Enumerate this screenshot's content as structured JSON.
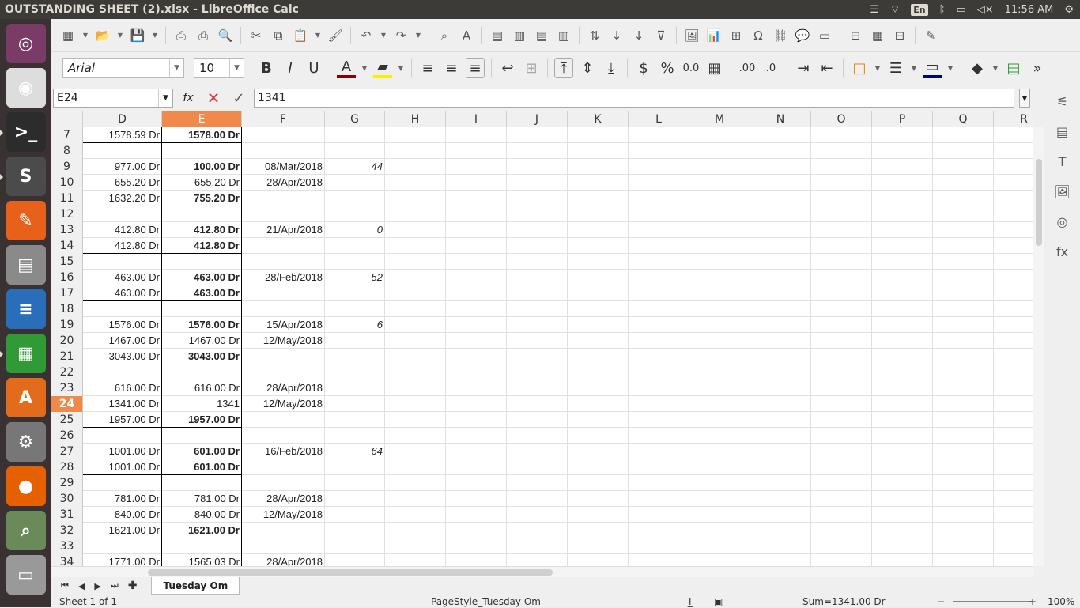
{
  "window": {
    "title": "OUTSTANDING  SHEET (2).xlsx - LibreOffice Calc"
  },
  "tray": {
    "lang": "En",
    "clock": "11:56 AM"
  },
  "launcher": [
    {
      "name": "ubuntu-dash-icon",
      "glyph": "◎",
      "color": "#7a3b67"
    },
    {
      "name": "chrome-icon",
      "glyph": "◉",
      "color": "#dddddd"
    },
    {
      "name": "terminal-icon",
      "glyph": ">_",
      "color": "#2c2c2c"
    },
    {
      "name": "sublime-text-icon",
      "glyph": "S",
      "color": "#4b4b4b"
    },
    {
      "name": "gpick-icon",
      "glyph": "✎",
      "color": "#e8611a"
    },
    {
      "name": "files-icon",
      "glyph": "▤",
      "color": "#8a8a8a"
    },
    {
      "name": "writer-icon",
      "glyph": "≡",
      "color": "#2a6db8"
    },
    {
      "name": "calc-icon",
      "glyph": "▦",
      "color": "#2f9a36"
    },
    {
      "name": "software-center-icon",
      "glyph": "A",
      "color": "#e36b1c"
    },
    {
      "name": "settings-icon",
      "glyph": "⚙",
      "color": "#777777"
    },
    {
      "name": "firefox-icon",
      "glyph": "●",
      "color": "#e66000"
    },
    {
      "name": "image-viewer-icon",
      "glyph": "⌕",
      "color": "#6a8a5a"
    },
    {
      "name": "trash-icon",
      "glyph": "▭",
      "color": "#999999"
    }
  ],
  "toolbar": {
    "font_name": "Arial",
    "font_size": "10"
  },
  "formula_bar": {
    "name_box": "E24",
    "fx": "fx",
    "value": "1341"
  },
  "columns": [
    "D",
    "E",
    "F",
    "G",
    "H",
    "I",
    "J",
    "K",
    "L",
    "M",
    "N",
    "O",
    "P",
    "Q",
    "R"
  ],
  "selected_column": "E",
  "rows": [
    {
      "n": "7",
      "d": "1578.59 Dr",
      "e": "1578.00 Dr",
      "eb": true,
      "f": "",
      "g": "",
      "bb": true
    },
    {
      "n": "8",
      "d": "",
      "e": "",
      "f": "",
      "g": ""
    },
    {
      "n": "9",
      "d": "977.00 Dr",
      "e": "100.00 Dr",
      "eb": true,
      "f": "08/Mar/2018",
      "g": "44"
    },
    {
      "n": "10",
      "d": "655.20 Dr",
      "e": "655.20 Dr",
      "f": "28/Apr/2018",
      "g": ""
    },
    {
      "n": "11",
      "d": "1632.20 Dr",
      "e": "755.20 Dr",
      "eb": true,
      "f": "",
      "g": "",
      "bb": true
    },
    {
      "n": "12",
      "d": "",
      "e": "",
      "f": "",
      "g": ""
    },
    {
      "n": "13",
      "d": "412.80 Dr",
      "e": "412.80 Dr",
      "eb": true,
      "f": "21/Apr/2018",
      "g": "0"
    },
    {
      "n": "14",
      "d": "412.80 Dr",
      "e": "412.80 Dr",
      "eb": true,
      "f": "",
      "g": "",
      "bb": true
    },
    {
      "n": "15",
      "d": "",
      "e": "",
      "f": "",
      "g": ""
    },
    {
      "n": "16",
      "d": "463.00 Dr",
      "e": "463.00 Dr",
      "eb": true,
      "f": "28/Feb/2018",
      "g": "52"
    },
    {
      "n": "17",
      "d": "463.00 Dr",
      "e": "463.00 Dr",
      "eb": true,
      "f": "",
      "g": "",
      "bb": true
    },
    {
      "n": "18",
      "d": "",
      "e": "",
      "f": "",
      "g": ""
    },
    {
      "n": "19",
      "d": "1576.00 Dr",
      "e": "1576.00 Dr",
      "eb": true,
      "f": "15/Apr/2018",
      "g": "6"
    },
    {
      "n": "20",
      "d": "1467.00 Dr",
      "e": "1467.00 Dr",
      "f": "12/May/2018",
      "g": ""
    },
    {
      "n": "21",
      "d": "3043.00 Dr",
      "e": "3043.00 Dr",
      "eb": true,
      "f": "",
      "g": "",
      "bb": true
    },
    {
      "n": "22",
      "d": "",
      "e": "",
      "f": "",
      "g": ""
    },
    {
      "n": "23",
      "d": "616.00 Dr",
      "e": "616.00 Dr",
      "f": "28/Apr/2018",
      "g": ""
    },
    {
      "n": "24",
      "d": "1341.00 Dr",
      "e": "1341",
      "f": "12/May/2018",
      "g": "",
      "sel": true
    },
    {
      "n": "25",
      "d": "1957.00 Dr",
      "e": "1957.00 Dr",
      "eb": true,
      "f": "",
      "g": "",
      "bb": true
    },
    {
      "n": "26",
      "d": "",
      "e": "",
      "f": "",
      "g": ""
    },
    {
      "n": "27",
      "d": "1001.00 Dr",
      "e": "601.00 Dr",
      "eb": true,
      "f": "16/Feb/2018",
      "g": "64"
    },
    {
      "n": "28",
      "d": "1001.00 Dr",
      "e": "601.00 Dr",
      "eb": true,
      "f": "",
      "g": "",
      "bb": true
    },
    {
      "n": "29",
      "d": "",
      "e": "",
      "f": "",
      "g": ""
    },
    {
      "n": "30",
      "d": "781.00 Dr",
      "e": "781.00 Dr",
      "f": "28/Apr/2018",
      "g": ""
    },
    {
      "n": "31",
      "d": "840.00 Dr",
      "e": "840.00 Dr",
      "f": "12/May/2018",
      "g": ""
    },
    {
      "n": "32",
      "d": "1621.00 Dr",
      "e": "1621.00 Dr",
      "eb": true,
      "f": "",
      "g": "",
      "bb": true
    },
    {
      "n": "33",
      "d": "",
      "e": "",
      "f": "",
      "g": ""
    },
    {
      "n": "34",
      "d": "1771.00 Dr",
      "e": "1565.03 Dr",
      "f": "28/Apr/2018",
      "g": ""
    }
  ],
  "sheet_tab": "Tuesday Om",
  "statusbar": {
    "sheet": "Sheet 1 of 1",
    "page_style": "PageStyle_Tuesday Om",
    "sum": "Sum=1341.00 Dr",
    "zoom": "100%"
  }
}
